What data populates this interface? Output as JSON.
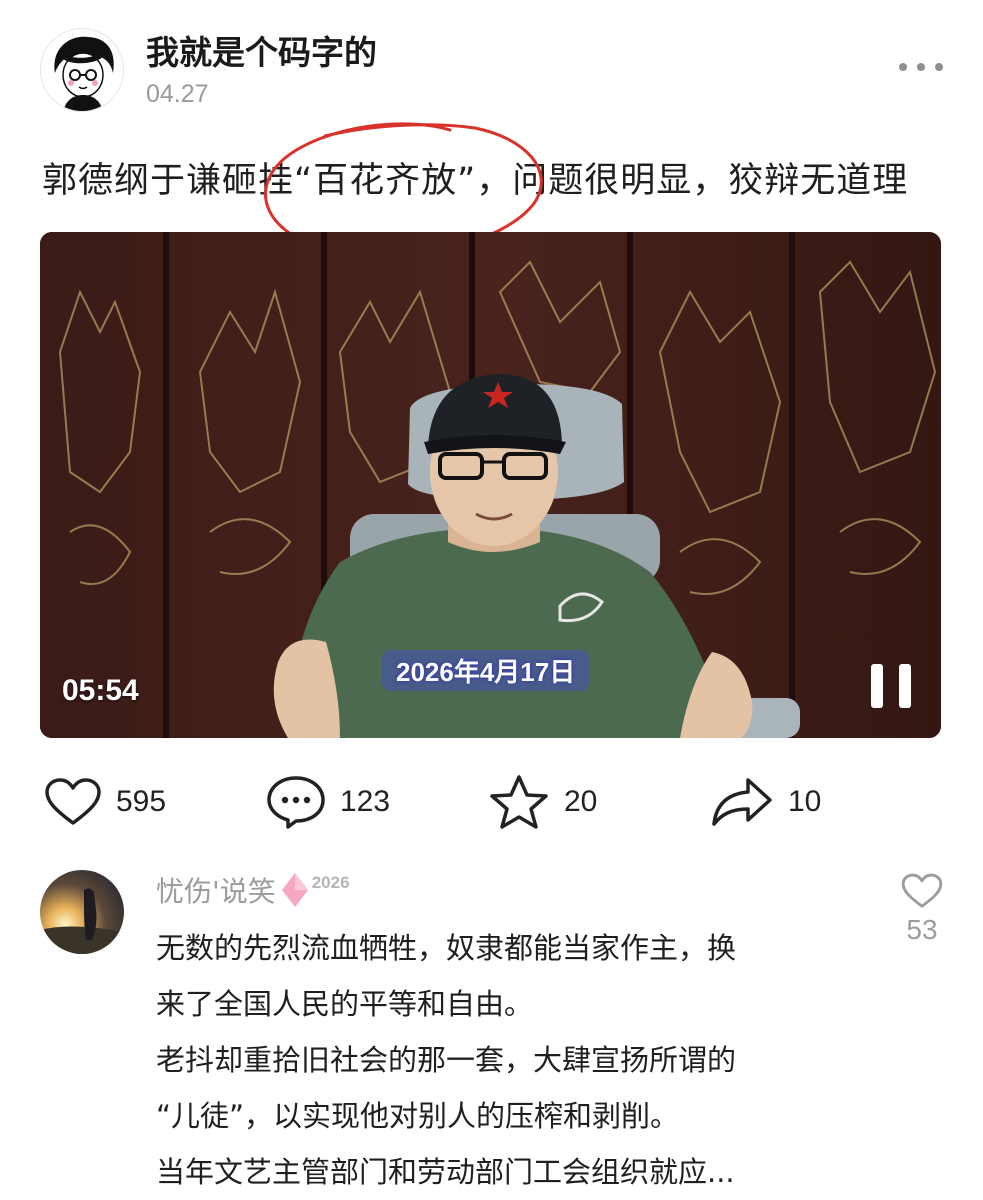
{
  "post": {
    "author_name": "我就是个码字的",
    "date": "04.27",
    "title": "郭德纲于谦砸挂“百花齐放”，问题很明显，狡辩无道理"
  },
  "video": {
    "duration": "05:54",
    "date_caption": "2026年4月17日",
    "state": "playing"
  },
  "actions": {
    "likes": "595",
    "comments": "123",
    "favorites": "20",
    "shares": "10"
  },
  "comment": {
    "username": "忧伤'说笑",
    "level": "2026",
    "lines": [
      "无数的先烈流血牺牲，奴隶都能当家作主，换",
      "来了全国人民的平等和自由。",
      "老抖却重拾旧社会的那一套，大肆宣扬所谓的",
      "“儿徒”，以实现他对别人的压榨和剥削。",
      "当年文艺主管部门和劳动部门工会组织就应..."
    ],
    "like_count": "53"
  },
  "colors": {
    "annotation_red": "#d9322b",
    "badge_pink": "#f7a6c4",
    "text_gray": "#9c9c9c"
  },
  "icons": [
    "more-icon",
    "heart-icon",
    "comment-icon",
    "star-icon",
    "share-icon",
    "pause-icon",
    "diamond-badge-icon"
  ]
}
